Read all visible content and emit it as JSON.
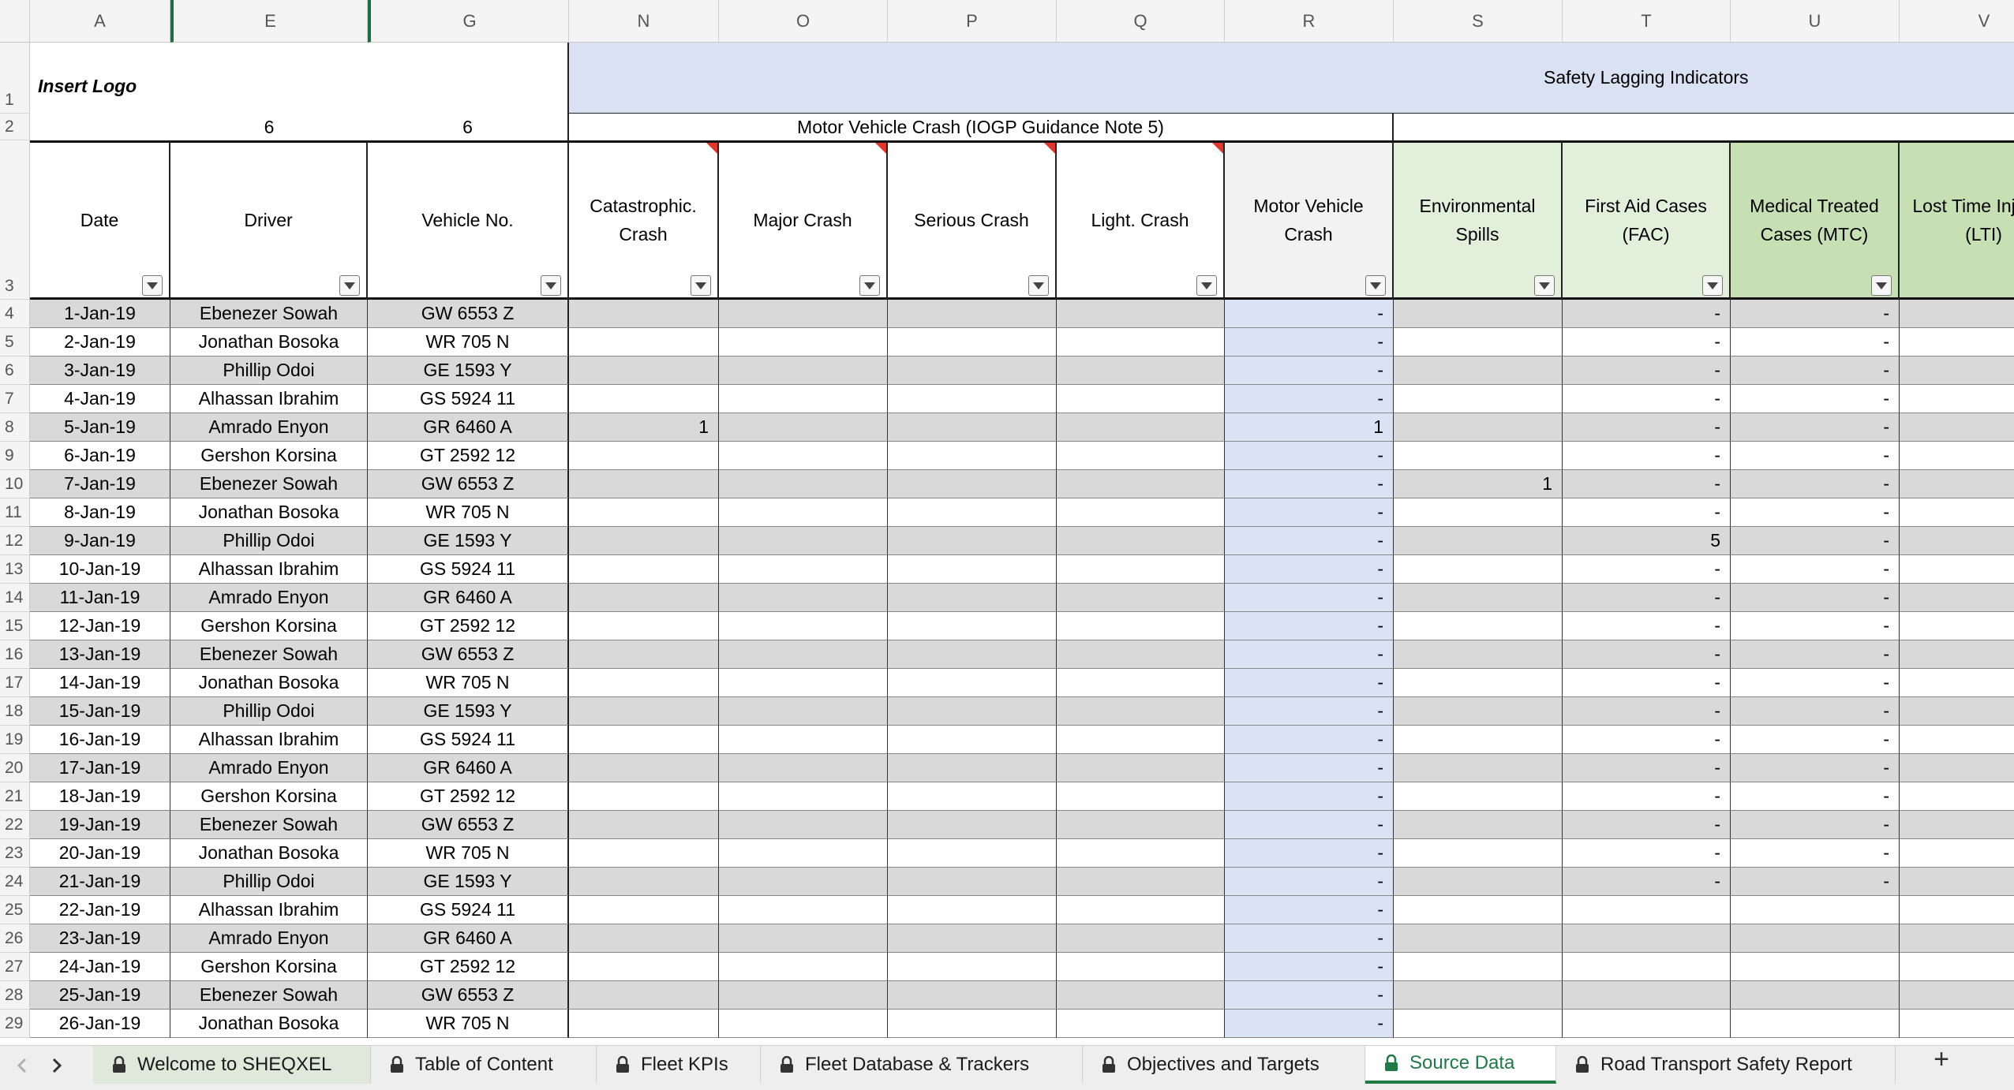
{
  "columns": [
    {
      "letter": "A",
      "w": 178
    },
    {
      "letter": "E",
      "w": 250
    },
    {
      "letter": "G",
      "w": 255
    },
    {
      "letter": "N",
      "w": 190
    },
    {
      "letter": "O",
      "w": 214
    },
    {
      "letter": "P",
      "w": 214
    },
    {
      "letter": "Q",
      "w": 213
    },
    {
      "letter": "R",
      "w": 214
    },
    {
      "letter": "S",
      "w": 214
    },
    {
      "letter": "T",
      "w": 213
    },
    {
      "letter": "U",
      "w": 214
    },
    {
      "letter": "V",
      "w": 215
    }
  ],
  "header": {
    "logo_text": "Insert Logo",
    "safety_lagging_title": "Safety Lagging Indicators",
    "motor_vehicle_group": "Motor Vehicle Crash (IOGP Guidance Note 5)",
    "row2_e": "6",
    "row2_g": "6",
    "field_headers": [
      "Date",
      "Driver",
      "Vehicle No.",
      "Catastrophic. Crash",
      "Major Crash",
      "Serious Crash",
      "Light. Crash",
      "Motor Vehicle Crash",
      "Environmental Spills",
      "First Aid Cases (FAC)",
      "Medical Treated Cases (MTC)",
      "Lost Time Injuries (LTI)"
    ]
  },
  "colors": {
    "band_blue": "#d9e1f2",
    "light_green": "#e2efda",
    "green": "#c6e0b4",
    "row_gray": "#d9d9d9",
    "r_blue": "#dae3f3",
    "accent_green": "#1f7a45",
    "red_indicator": "#e0362c"
  },
  "rows": [
    {
      "num": "4",
      "date": "1-Jan-19",
      "driver": "Ebenezer Sowah",
      "vehicle": "GW 6553 Z",
      "n": "",
      "r": "-",
      "s": "",
      "t": "-",
      "u": "-"
    },
    {
      "num": "5",
      "date": "2-Jan-19",
      "driver": "Jonathan Bosoka",
      "vehicle": "WR 705 N",
      "n": "",
      "r": "-",
      "s": "",
      "t": "-",
      "u": "-"
    },
    {
      "num": "6",
      "date": "3-Jan-19",
      "driver": "Phillip Odoi",
      "vehicle": "GE 1593 Y",
      "n": "",
      "r": "-",
      "s": "",
      "t": "-",
      "u": "-"
    },
    {
      "num": "7",
      "date": "4-Jan-19",
      "driver": "Alhassan Ibrahim",
      "vehicle": "GS 5924 11",
      "n": "",
      "r": "-",
      "s": "",
      "t": "-",
      "u": "-"
    },
    {
      "num": "8",
      "date": "5-Jan-19",
      "driver": "Amrado Enyon",
      "vehicle": "GR 6460 A",
      "n": "1",
      "r": "1",
      "s": "",
      "t": "-",
      "u": "-"
    },
    {
      "num": "9",
      "date": "6-Jan-19",
      "driver": "Gershon Korsina",
      "vehicle": "GT 2592 12",
      "n": "",
      "r": "-",
      "s": "",
      "t": "-",
      "u": "-"
    },
    {
      "num": "10",
      "date": "7-Jan-19",
      "driver": "Ebenezer Sowah",
      "vehicle": "GW 6553 Z",
      "n": "",
      "r": "-",
      "s": "1",
      "t": "-",
      "u": "-"
    },
    {
      "num": "11",
      "date": "8-Jan-19",
      "driver": "Jonathan Bosoka",
      "vehicle": "WR 705 N",
      "n": "",
      "r": "-",
      "s": "",
      "t": "-",
      "u": "-"
    },
    {
      "num": "12",
      "date": "9-Jan-19",
      "driver": "Phillip Odoi",
      "vehicle": "GE 1593 Y",
      "n": "",
      "r": "-",
      "s": "",
      "t": "5",
      "u": "-"
    },
    {
      "num": "13",
      "date": "10-Jan-19",
      "driver": "Alhassan Ibrahim",
      "vehicle": "GS 5924 11",
      "n": "",
      "r": "-",
      "s": "",
      "t": "-",
      "u": "-"
    },
    {
      "num": "14",
      "date": "11-Jan-19",
      "driver": "Amrado Enyon",
      "vehicle": "GR 6460 A",
      "n": "",
      "r": "-",
      "s": "",
      "t": "-",
      "u": "-"
    },
    {
      "num": "15",
      "date": "12-Jan-19",
      "driver": "Gershon Korsina",
      "vehicle": "GT 2592 12",
      "n": "",
      "r": "-",
      "s": "",
      "t": "-",
      "u": "-"
    },
    {
      "num": "16",
      "date": "13-Jan-19",
      "driver": "Ebenezer Sowah",
      "vehicle": "GW 6553 Z",
      "n": "",
      "r": "-",
      "s": "",
      "t": "-",
      "u": "-"
    },
    {
      "num": "17",
      "date": "14-Jan-19",
      "driver": "Jonathan Bosoka",
      "vehicle": "WR 705 N",
      "n": "",
      "r": "-",
      "s": "",
      "t": "-",
      "u": "-"
    },
    {
      "num": "18",
      "date": "15-Jan-19",
      "driver": "Phillip Odoi",
      "vehicle": "GE 1593 Y",
      "n": "",
      "r": "-",
      "s": "",
      "t": "-",
      "u": "-"
    },
    {
      "num": "19",
      "date": "16-Jan-19",
      "driver": "Alhassan Ibrahim",
      "vehicle": "GS 5924 11",
      "n": "",
      "r": "-",
      "s": "",
      "t": "-",
      "u": "-"
    },
    {
      "num": "20",
      "date": "17-Jan-19",
      "driver": "Amrado Enyon",
      "vehicle": "GR 6460 A",
      "n": "",
      "r": "-",
      "s": "",
      "t": "-",
      "u": "-"
    },
    {
      "num": "21",
      "date": "18-Jan-19",
      "driver": "Gershon Korsina",
      "vehicle": "GT 2592 12",
      "n": "",
      "r": "-",
      "s": "",
      "t": "-",
      "u": "-"
    },
    {
      "num": "22",
      "date": "19-Jan-19",
      "driver": "Ebenezer Sowah",
      "vehicle": "GW 6553 Z",
      "n": "",
      "r": "-",
      "s": "",
      "t": "-",
      "u": "-"
    },
    {
      "num": "23",
      "date": "20-Jan-19",
      "driver": "Jonathan Bosoka",
      "vehicle": "WR 705 N",
      "n": "",
      "r": "-",
      "s": "",
      "t": "-",
      "u": "-"
    },
    {
      "num": "24",
      "date": "21-Jan-19",
      "driver": "Phillip Odoi",
      "vehicle": "GE 1593 Y",
      "n": "",
      "r": "-",
      "s": "",
      "t": "-",
      "u": "-"
    },
    {
      "num": "25",
      "date": "22-Jan-19",
      "driver": "Alhassan Ibrahim",
      "vehicle": "GS 5924 11",
      "n": "",
      "r": "-",
      "s": "",
      "t": "",
      "u": ""
    },
    {
      "num": "26",
      "date": "23-Jan-19",
      "driver": "Amrado Enyon",
      "vehicle": "GR 6460 A",
      "n": "",
      "r": "-",
      "s": "",
      "t": "",
      "u": ""
    },
    {
      "num": "27",
      "date": "24-Jan-19",
      "driver": "Gershon Korsina",
      "vehicle": "GT 2592 12",
      "n": "",
      "r": "-",
      "s": "",
      "t": "",
      "u": ""
    },
    {
      "num": "28",
      "date": "25-Jan-19",
      "driver": "Ebenezer Sowah",
      "vehicle": "GW 6553 Z",
      "n": "",
      "r": "-",
      "s": "",
      "t": "",
      "u": ""
    },
    {
      "num": "29",
      "date": "26-Jan-19",
      "driver": "Jonathan Bosoka",
      "vehicle": "WR 705 N",
      "n": "",
      "r": "-",
      "s": "",
      "t": "",
      "u": ""
    }
  ],
  "tabs": [
    {
      "label": "Welcome to SHEQXEL",
      "locked": true,
      "active": false
    },
    {
      "label": "Table of Content",
      "locked": true,
      "active": false
    },
    {
      "label": "Fleet KPIs",
      "locked": true,
      "active": false
    },
    {
      "label": "Fleet Database & Trackers",
      "locked": true,
      "active": false
    },
    {
      "label": "Objectives and Targets",
      "locked": true,
      "active": false
    },
    {
      "label": "Source Data",
      "locked": true,
      "active": true
    },
    {
      "label": "Road Transport Safety Report",
      "locked": true,
      "active": false
    }
  ],
  "add_sheet_label": "+"
}
